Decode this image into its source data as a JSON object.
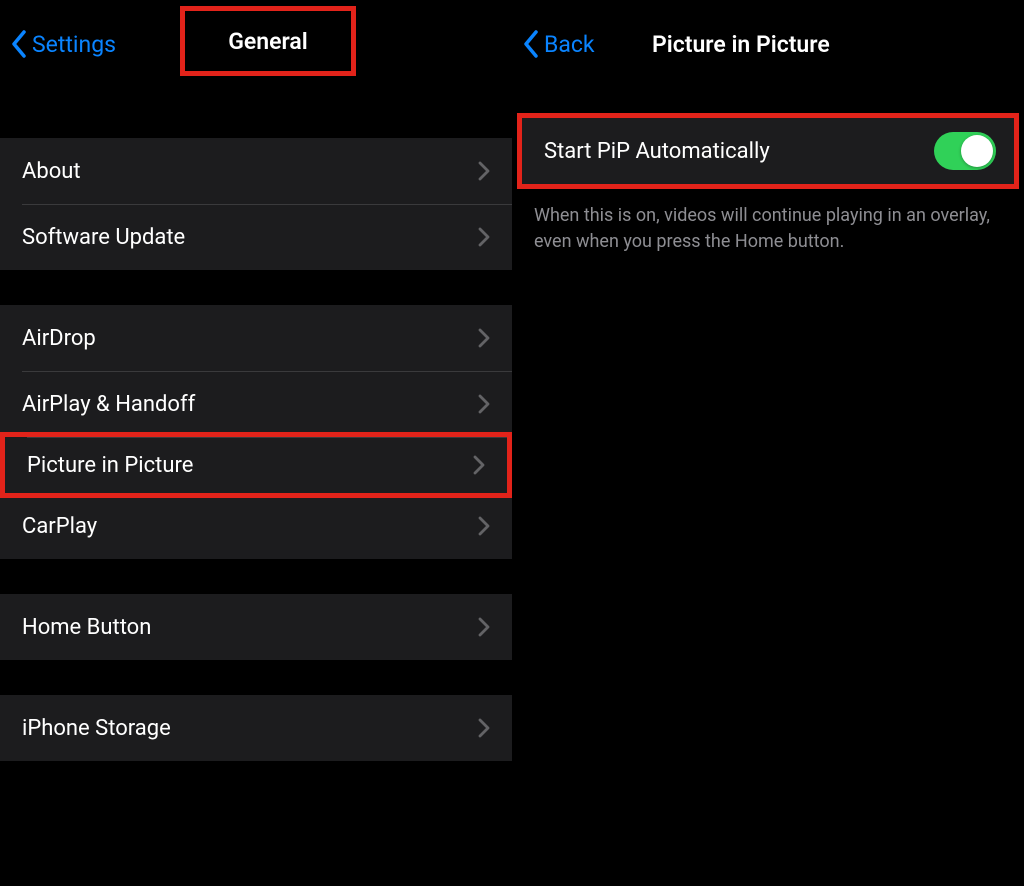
{
  "left": {
    "back_label": "Settings",
    "title": "General",
    "group1": {
      "about": "About",
      "software_update": "Software Update"
    },
    "group2": {
      "airdrop": "AirDrop",
      "airplay_handoff": "AirPlay & Handoff",
      "picture_in_picture": "Picture in Picture",
      "carplay": "CarPlay"
    },
    "group3": {
      "home_button": "Home Button"
    },
    "group4": {
      "iphone_storage": "iPhone Storage"
    }
  },
  "right": {
    "back_label": "Back",
    "title": "Picture in Picture",
    "toggle_label": "Start PiP Automatically",
    "toggle_on": true,
    "footer": "When this is on, videos will continue playing in an overlay, even when you press the Home button."
  },
  "colors": {
    "accent": "#0a84ff",
    "highlight": "#e2231a",
    "toggle_on": "#30d158",
    "row_bg": "#1c1c1e"
  }
}
